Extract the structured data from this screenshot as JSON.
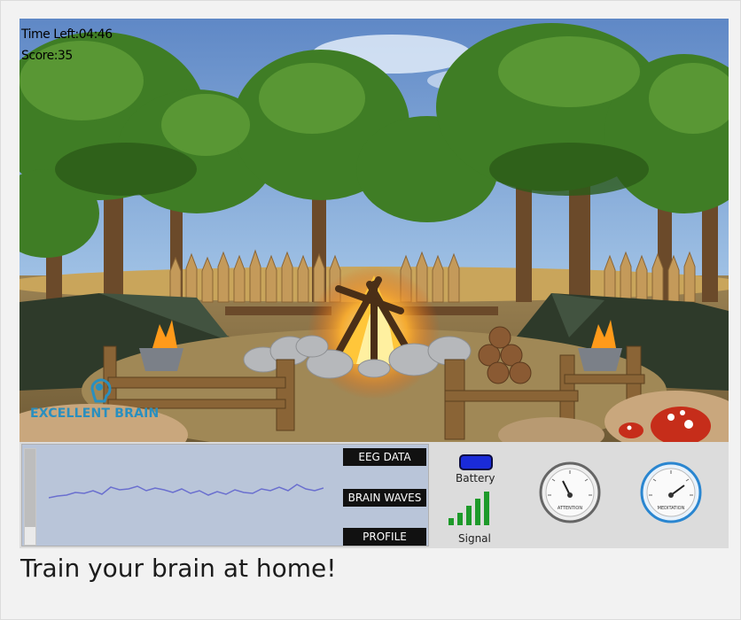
{
  "hud": {
    "time_left": "Time Left:04:46",
    "score": "Score:35"
  },
  "logo": {
    "text": "EXCELLENT BRAIN"
  },
  "panel": {
    "buttons": {
      "eeg_data": "EEG DATA",
      "brain_waves": "BRAIN WAVES",
      "profile": "PROFILE"
    },
    "battery_label": "Battery",
    "signal_label": "Signal",
    "signal_bars_lit": 5,
    "gauges": {
      "attention_label": "ATTENTION",
      "meditation_label": "MEDITATION"
    }
  },
  "caption": "Train your brain at home!",
  "colors": {
    "panel_bg": "#dcdcdc",
    "wave_bg": "#b9c5d9",
    "wave_line": "#6a6fcf",
    "battery": "#1a2bd8",
    "signal": "#1d9a2a",
    "logo": "#2a8fbf"
  }
}
